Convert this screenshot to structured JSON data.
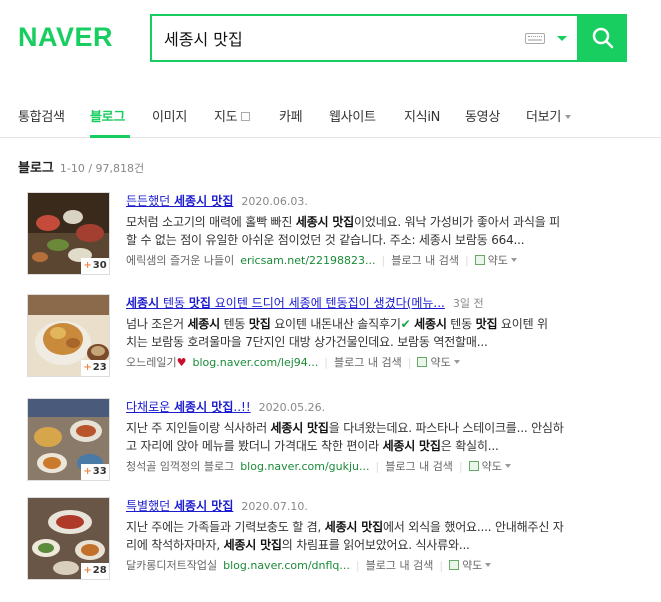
{
  "header": {
    "logo": "NAVER",
    "query": "세종시 맛집"
  },
  "tabs": [
    {
      "label": "통합검색"
    },
    {
      "label": "블로그"
    },
    {
      "label": "이미지"
    },
    {
      "label": "지도"
    },
    {
      "label": "카페"
    },
    {
      "label": "웹사이트"
    },
    {
      "label": "지식iN"
    },
    {
      "label": "동영상"
    },
    {
      "label": "더보기"
    }
  ],
  "section": {
    "title": "블로그",
    "count": "1-10 / 97,818건"
  },
  "results": [
    {
      "title_pre": "든든했던 ",
      "title_bold": "세종시 맛집",
      "title_post": "",
      "date": "2020.06.03.",
      "line1_a": "모처럼 소고기의 매력에 홀빡 빠진 ",
      "line1_b": "세종시 맛집",
      "line1_c": "이었네요. 워낙 가성비가 좋아서 과식을 피",
      "line2": "할 수 없는 점이 유일한 아쉬운 점이었던 것 같습니다. 주소: 세종시 보람동 664...",
      "author": "에릭샘의 즐거운 나들이",
      "url": "ericsam.net/22198823...",
      "blog_search": "블로그 내 검색",
      "map": "약도",
      "badge": "30"
    },
    {
      "title_pre": "",
      "title_bold": "세종시",
      "title_mid": " 텐동 ",
      "title_bold2": "맛집",
      "title_post": " 요이텐 드디어 세종에 텐동집이 생겼다(메뉴...",
      "date": "3일 전",
      "line1_a": "넘나 조은거 ",
      "line1_b": "세종시",
      "line1_c": " 텐동 ",
      "line1_d": "맛집",
      "line1_e": " 요이텐 내돈내산 솔직후기",
      "line1_f": " ",
      "line1_g": "세종시",
      "line1_h": " 텐동 ",
      "line1_i": "맛집",
      "line1_j": " 요이텐 위",
      "line2": "치는 보람동 호려울마을 7단지인 대방 상가건물인데요. 보람동 역전할매...",
      "author": "오느레일기",
      "url": "blog.naver.com/lej94...",
      "blog_search": "블로그 내 검색",
      "map": "약도",
      "badge": "23"
    },
    {
      "title_pre": "다채로운 ",
      "title_bold": "세종시 맛집",
      "title_post": "..!!",
      "date": "2020.05.26.",
      "line1_a": "지난 주 지인들이랑 식사하러 ",
      "line1_b": "세종시 맛집",
      "line1_c": "을 다녀왔는데요. 파스타나 스테이크를... 안심하",
      "line2_a": "고 자리에 앉아 메뉴를 봤더니 가격대도 착한 편이라 ",
      "line2_b": "세종시 맛집",
      "line2_c": "은 확실히...",
      "author": "청석골 임꺽정의 블로그",
      "url": "blog.naver.com/gukju...",
      "blog_search": "블로그 내 검색",
      "map": "약도",
      "badge": "33"
    },
    {
      "title_pre": "특별했던 ",
      "title_bold": "세종시 맛집",
      "title_post": "",
      "date": "2020.07.10.",
      "line1_a": "지난 주에는 가족들과 기력보충도 할 겸, ",
      "line1_b": "세종시 맛집",
      "line1_c": "에서 외식을 했어요.... 안내해주신 자",
      "line2_a": "리에 착석하자마자, ",
      "line2_b": "세종시 맛집",
      "line2_c": "의 차림표를 읽어보았어요. 식사류와...",
      "author": "달카롱디저트작업실",
      "url": "blog.naver.com/dnflq...",
      "blog_search": "블로그 내 검색",
      "map": "약도",
      "badge": "28"
    }
  ]
}
